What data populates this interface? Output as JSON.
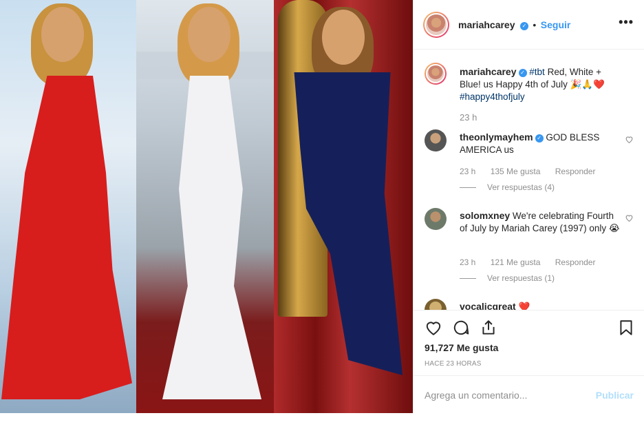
{
  "post": {
    "username": "mariahcarey",
    "follow_label": "Seguir",
    "more_label": "•••",
    "verified_glyph": "✓"
  },
  "caption": {
    "username": "mariahcarey",
    "tag": "#tbt",
    "text": " Red, White + Blue! us Happy 4th of July 🎉🙏❤️",
    "hashtag": "#happy4thofjuly",
    "time": "23 h"
  },
  "comments": [
    {
      "username": "theonlymayhem",
      "text": " GOD BLESS AMERICA us",
      "time": "23 h",
      "likes": "135 Me gusta",
      "reply_label": "Responder",
      "view_replies": "Ver respuestas (4)"
    },
    {
      "username": "solomxney",
      "text": " We're celebrating Fourth of July by Mariah Carey (1997) only 😭",
      "time": "23 h",
      "likes": "121 Me gusta",
      "reply_label": "Responder",
      "view_replies": "Ver respuestas (1)"
    },
    {
      "username": "vocalicgreat",
      "text": " ❤️"
    }
  ],
  "actions": {
    "likes_count": "91,727 Me gusta",
    "time_ago": "HACE 23 HORAS"
  },
  "add_comment": {
    "placeholder": "Agrega un comentario...",
    "publish_label": "Publicar"
  },
  "icons": [
    "heart-icon",
    "comment-icon",
    "share-icon",
    "bookmark-icon",
    "more-icon",
    "verified-icon"
  ],
  "colors": {
    "link_blue": "#3897f0",
    "hashtag_blue": "#003569",
    "muted": "#8e8e8e",
    "publish_disabled": "#b2dffc"
  }
}
